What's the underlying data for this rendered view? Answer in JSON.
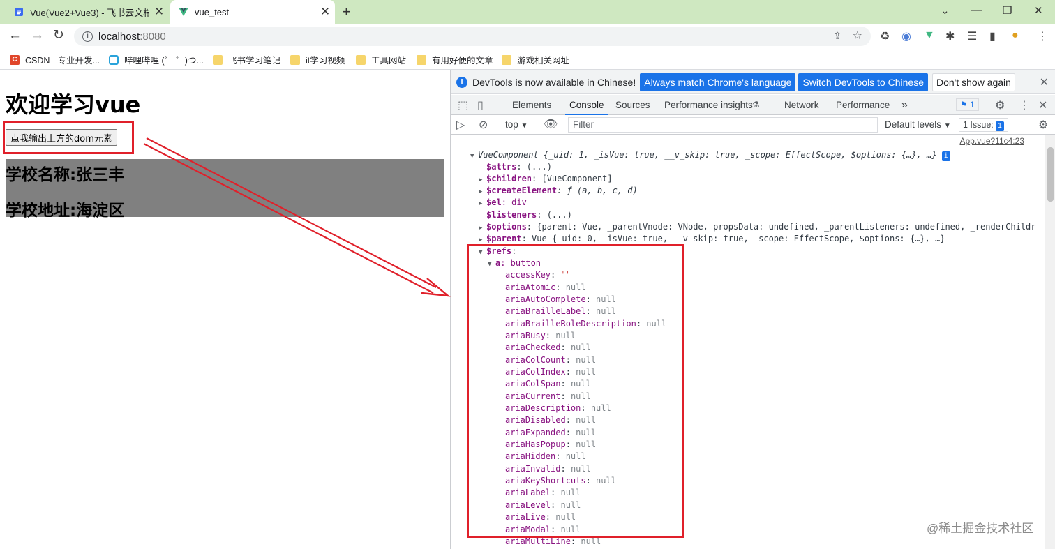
{
  "browser": {
    "tabs": [
      {
        "title": "Vue(Vue2+Vue3) - 飞书云文档",
        "icon": "doc-icon",
        "close": "✕"
      },
      {
        "title": "vue_test",
        "icon": "vue-logo-icon",
        "close": "✕"
      }
    ],
    "new_tab": "+",
    "address": {
      "host": "localhost",
      "port": ":8080"
    },
    "bookmarks": [
      {
        "label": "CSDN - 专业开发...",
        "icon": "csdn-icon"
      },
      {
        "label": "哔哩哔哩 (゜-゜)つ...",
        "icon": "bilibili-icon"
      },
      {
        "label": "飞书学习笔记",
        "icon": "folder-icon"
      },
      {
        "label": "it学习视频",
        "icon": "folder-icon"
      },
      {
        "label": "工具网站",
        "icon": "folder-icon"
      },
      {
        "label": "有用好便的文章",
        "icon": "folder-icon"
      },
      {
        "label": "游戏相关网址",
        "icon": "folder-icon"
      }
    ]
  },
  "page": {
    "heading": "欢迎学习vue",
    "button_label": "点我输出上方的dom元素",
    "school_name": "学校名称:张三丰",
    "school_address": "学校地址:海淀区"
  },
  "devtools": {
    "infobar": {
      "message": "DevTools is now available in Chinese!",
      "btn_match": "Always match Chrome's language",
      "btn_switch": "Switch DevTools to Chinese",
      "btn_dismiss": "Don't show again"
    },
    "tabs": [
      "Elements",
      "Console",
      "Sources",
      "Performance insights",
      "Network",
      "Performance"
    ],
    "more_tabs": "»",
    "messages_badge": "1",
    "console_toolbar": {
      "context": "top",
      "filter_placeholder": "Filter",
      "levels": "Default levels",
      "issues_label": "1 Issue:",
      "issues_badge": "1"
    },
    "source_link": "App.vue?11c4:23"
  },
  "console_lines": {
    "vc": "VueComponent {_uid: 1, _isVue: true, __v_skip: true, _scope: EffectScope, $options: {…}, …}",
    "attrs_key": "$attrs",
    "attrs_val": ": (...)",
    "children_key": "$children",
    "children_val": ": [VueComponent]",
    "create_key": "$createElement",
    "create_val": ": ƒ (a, b, c, d)",
    "el_key": "$el",
    "el_val": ": div",
    "listeners_key": "$listeners",
    "listeners_val": ": (...)",
    "options_key": "$options",
    "options_val": ": {parent: Vue, _parentVnode: VNode, propsData: undefined, _parentListeners: undefined, _renderChildr",
    "parent_key": "$parent",
    "parent_val": ": Vue {_uid: 0, _isVue: true, __v_skip: true, _scope: EffectScope, $options: {…}, …}",
    "refs_key": "$refs",
    "refs_val": ":",
    "a_key": "a",
    "a_val": ": button",
    "access_key": "accessKey",
    "access_val": "\"\"",
    "props": [
      "ariaAtomic",
      "ariaAutoComplete",
      "ariaBrailleLabel",
      "ariaBrailleRoleDescription",
      "ariaBusy",
      "ariaChecked",
      "ariaColCount",
      "ariaColIndex",
      "ariaColSpan",
      "ariaCurrent",
      "ariaDescription",
      "ariaDisabled",
      "ariaExpanded",
      "ariaHasPopup",
      "ariaHidden",
      "ariaInvalid",
      "ariaKeyShortcuts",
      "ariaLabel",
      "ariaLevel",
      "ariaLive",
      "ariaModal",
      "ariaMultiLine"
    ],
    "null_text": "null"
  },
  "watermark": "@稀土掘金技术社区",
  "colors": {
    "annotation": "#e0202a",
    "accent": "#1a73e8",
    "tabstrip": "#cfe8c1",
    "school_bg": "#808080"
  }
}
